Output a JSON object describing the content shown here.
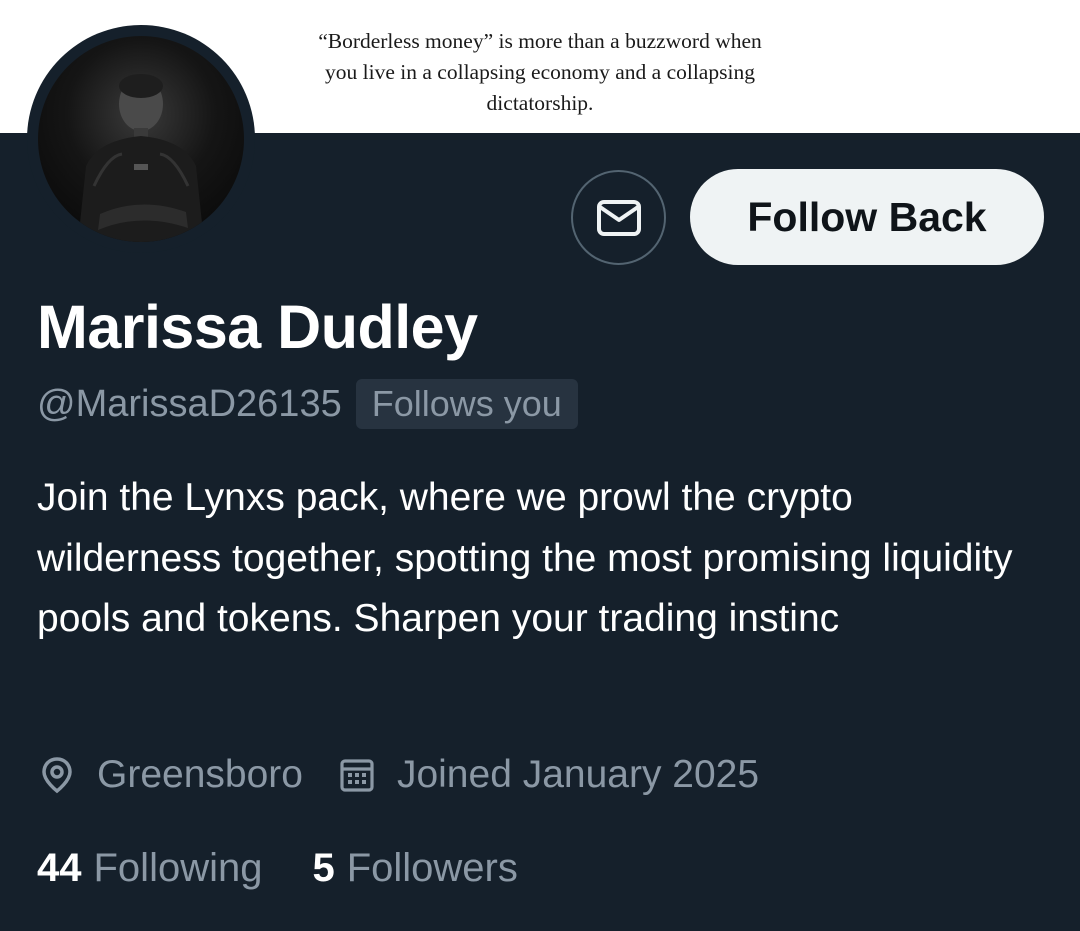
{
  "banner": {
    "quote": "“Borderless money” is more than a buzzword when you live in a collapsing economy and a collapsing dictatorship."
  },
  "profile": {
    "display_name": "Marissa Dudley",
    "handle": "@MarissaD26135",
    "follows_you_badge": "Follows you",
    "bio": "Join the Lynxs pack, where we prowl the crypto wilderness together, spotting the most promising liquidity pools and tokens. Sharpen your trading instinc",
    "location": "Greensboro",
    "joined": "Joined January 2025"
  },
  "actions": {
    "message_icon": "envelope-icon",
    "follow_back_label": "Follow Back"
  },
  "stats": {
    "following_count": "44",
    "following_label": "Following",
    "followers_count": "5",
    "followers_label": "Followers"
  },
  "colors": {
    "background": "#15202b",
    "secondary_text": "#8b98a5",
    "button_bg": "#eff3f4"
  }
}
